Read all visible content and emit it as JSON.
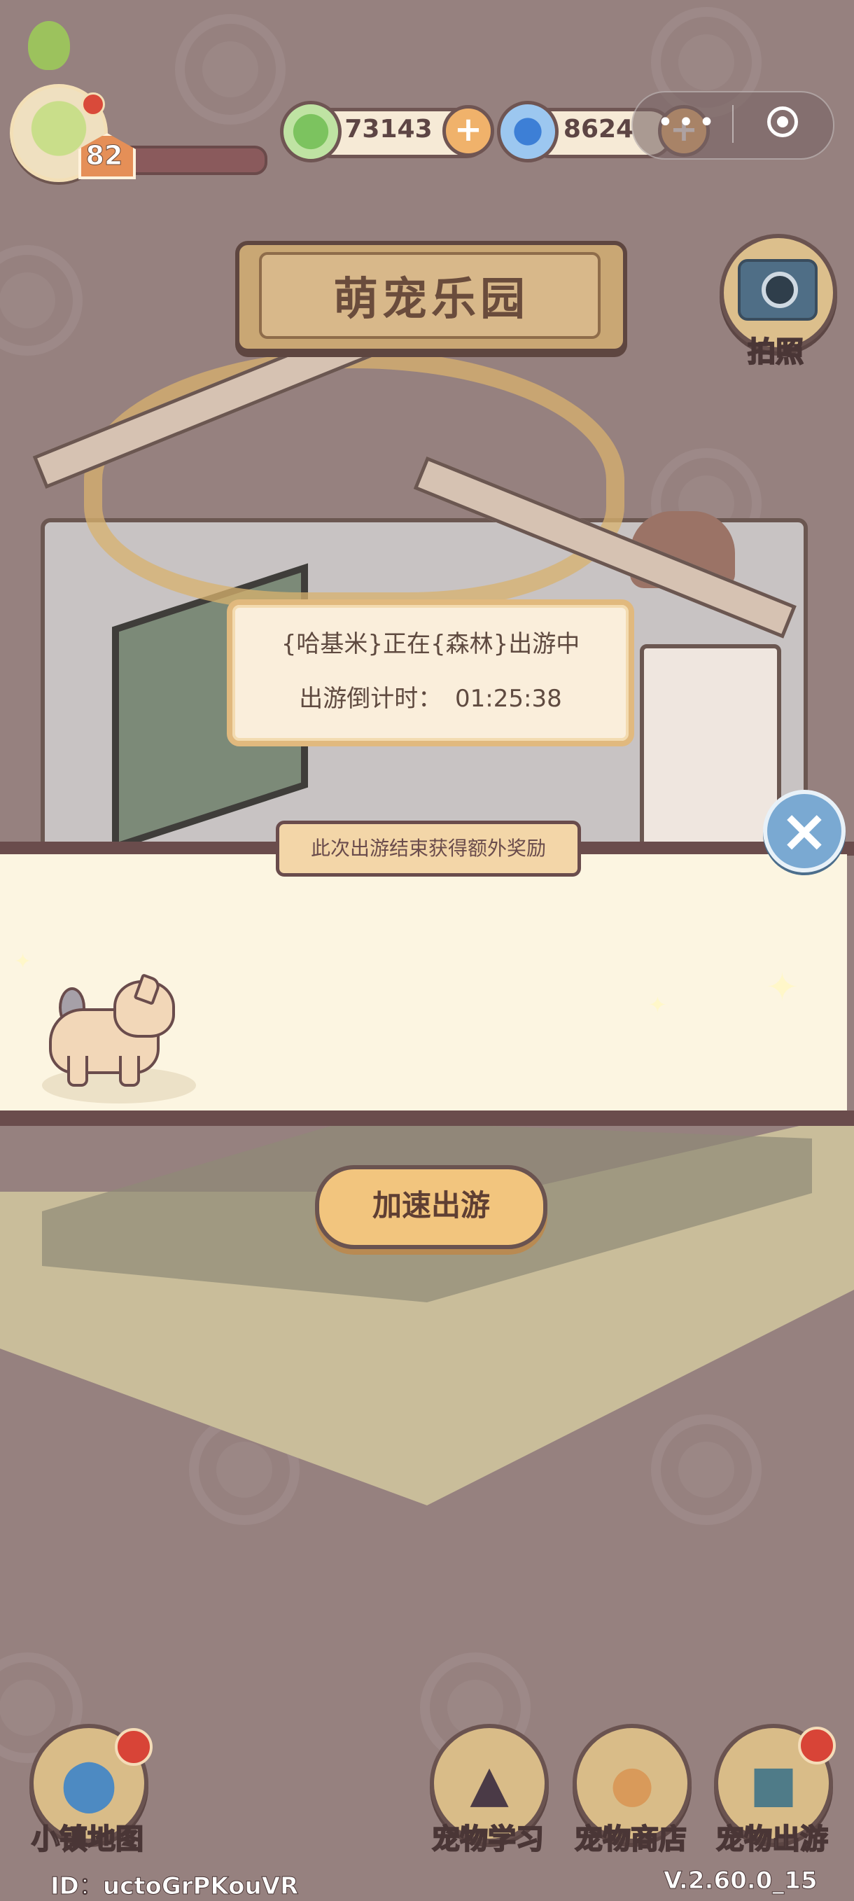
{
  "hud": {
    "level": "82",
    "clover_currency": "73143",
    "swirl_currency": "8624"
  },
  "title_sign": "萌宠乐园",
  "camera": {
    "label": "拍照"
  },
  "travel_status": {
    "line1": "{哈基米}正在{森林}出游中",
    "countdown_label": "出游倒计时：",
    "countdown_value": "01:25:38"
  },
  "reward_banner": {
    "label": "此次出游结束获得额外奖励"
  },
  "speed_button": "加速出游",
  "nav": {
    "map": "小镇地图",
    "learn": "宠物学习",
    "shop": "宠物商店",
    "travel": "宠物出游"
  },
  "footer": {
    "id": "ID：uctoGrPKouVR",
    "version": "V.2.60.0_15"
  },
  "colors": {
    "background": "#96817f",
    "banner": "#fcf5e1",
    "button": "#f2c57e",
    "badge": "#d84437"
  },
  "icons": [
    "clover-icon",
    "swirl-icon",
    "camera-icon",
    "close-icon",
    "map-pin-icon",
    "wizard-hat-icon",
    "shiba-icon",
    "suitcase-icon",
    "target-icon"
  ]
}
